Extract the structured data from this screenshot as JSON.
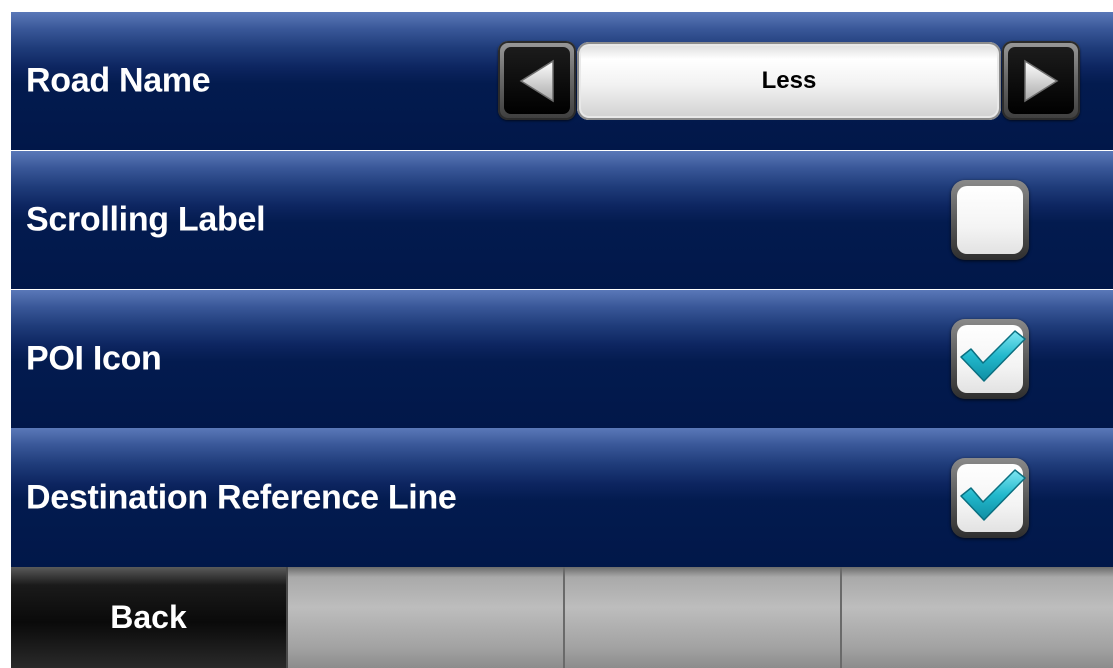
{
  "settings": [
    {
      "label": "Road Name",
      "type": "selector",
      "value": "Less"
    },
    {
      "label": "Scrolling Label",
      "type": "checkbox",
      "checked": false
    },
    {
      "label": "POI Icon",
      "type": "checkbox",
      "checked": true
    },
    {
      "label": "Destination Reference Line",
      "type": "checkbox",
      "checked": true
    }
  ],
  "bottom_bar": {
    "back_label": "Back",
    "tab2_label": "",
    "tab3_label": "",
    "tab4_label": ""
  },
  "colors": {
    "row_background": "#011749",
    "row_highlight": "#5a78b8",
    "checkmark": "#22b8cc",
    "text": "#ffffff"
  },
  "icons": {
    "prev": "triangle-left-icon",
    "next": "triangle-right-icon",
    "check": "checkmark-icon"
  }
}
